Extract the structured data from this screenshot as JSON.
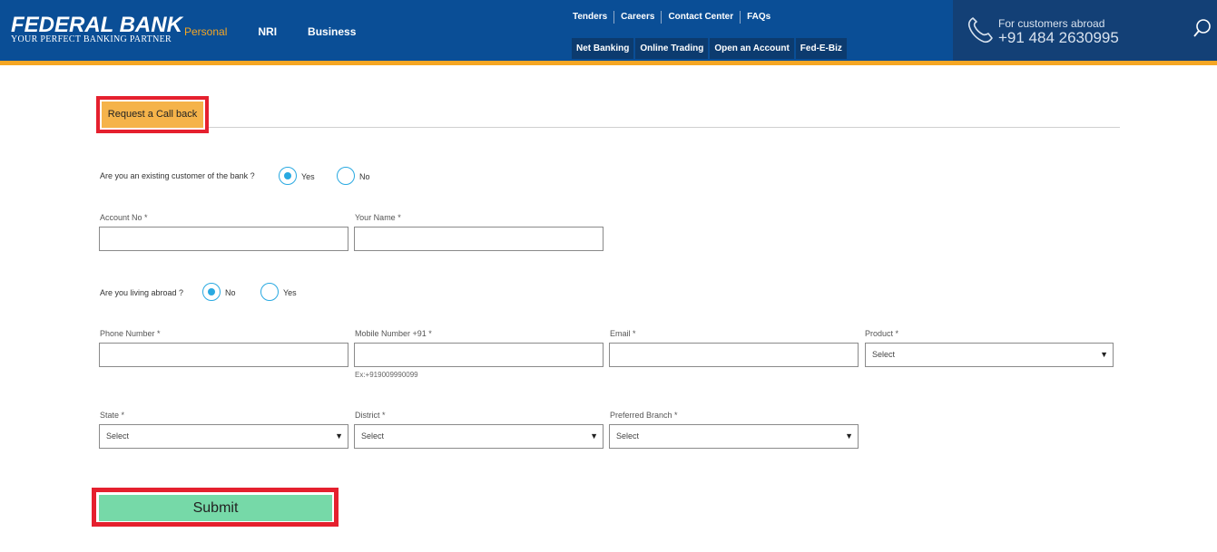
{
  "header": {
    "brand": "FEDERAL BANK",
    "tagline": "YOUR PERFECT BANKING PARTNER",
    "nav": [
      "Personal",
      "NRI",
      "Business"
    ],
    "top_links": [
      "Tenders",
      "Careers",
      "Contact Center",
      "FAQs"
    ],
    "quick_links": [
      "Net Banking",
      "Online Trading",
      "Open an Account",
      "Fed-E-Biz"
    ],
    "abroad_label": "For customers abroad",
    "abroad_number": "+91 484 2630995",
    "colors": {
      "primary": "#0a4e96",
      "accent": "#f5a623"
    }
  },
  "tab": {
    "label": "Request a Call back"
  },
  "form": {
    "existing_customer": {
      "question": "Are you an existing customer of the bank ?",
      "options": [
        "Yes",
        "No"
      ],
      "selected": "Yes"
    },
    "account_no_label": "Account No *",
    "your_name_label": "Your Name *",
    "living_abroad": {
      "question": "Are you living abroad ?",
      "options": [
        "No",
        "Yes"
      ],
      "selected": "No"
    },
    "phone_label": "Phone Number *",
    "mobile_label": "Mobile Number +91 *",
    "mobile_hint": "Ex:+919009990099",
    "email_label": "Email *",
    "product_label": "Product *",
    "product_value": "Select",
    "state_label": "State *",
    "state_value": "Select",
    "district_label": "District *",
    "district_value": "Select",
    "branch_label": "Preferred Branch *",
    "branch_value": "Select",
    "submit_label": "Submit",
    "caret": "▼"
  }
}
